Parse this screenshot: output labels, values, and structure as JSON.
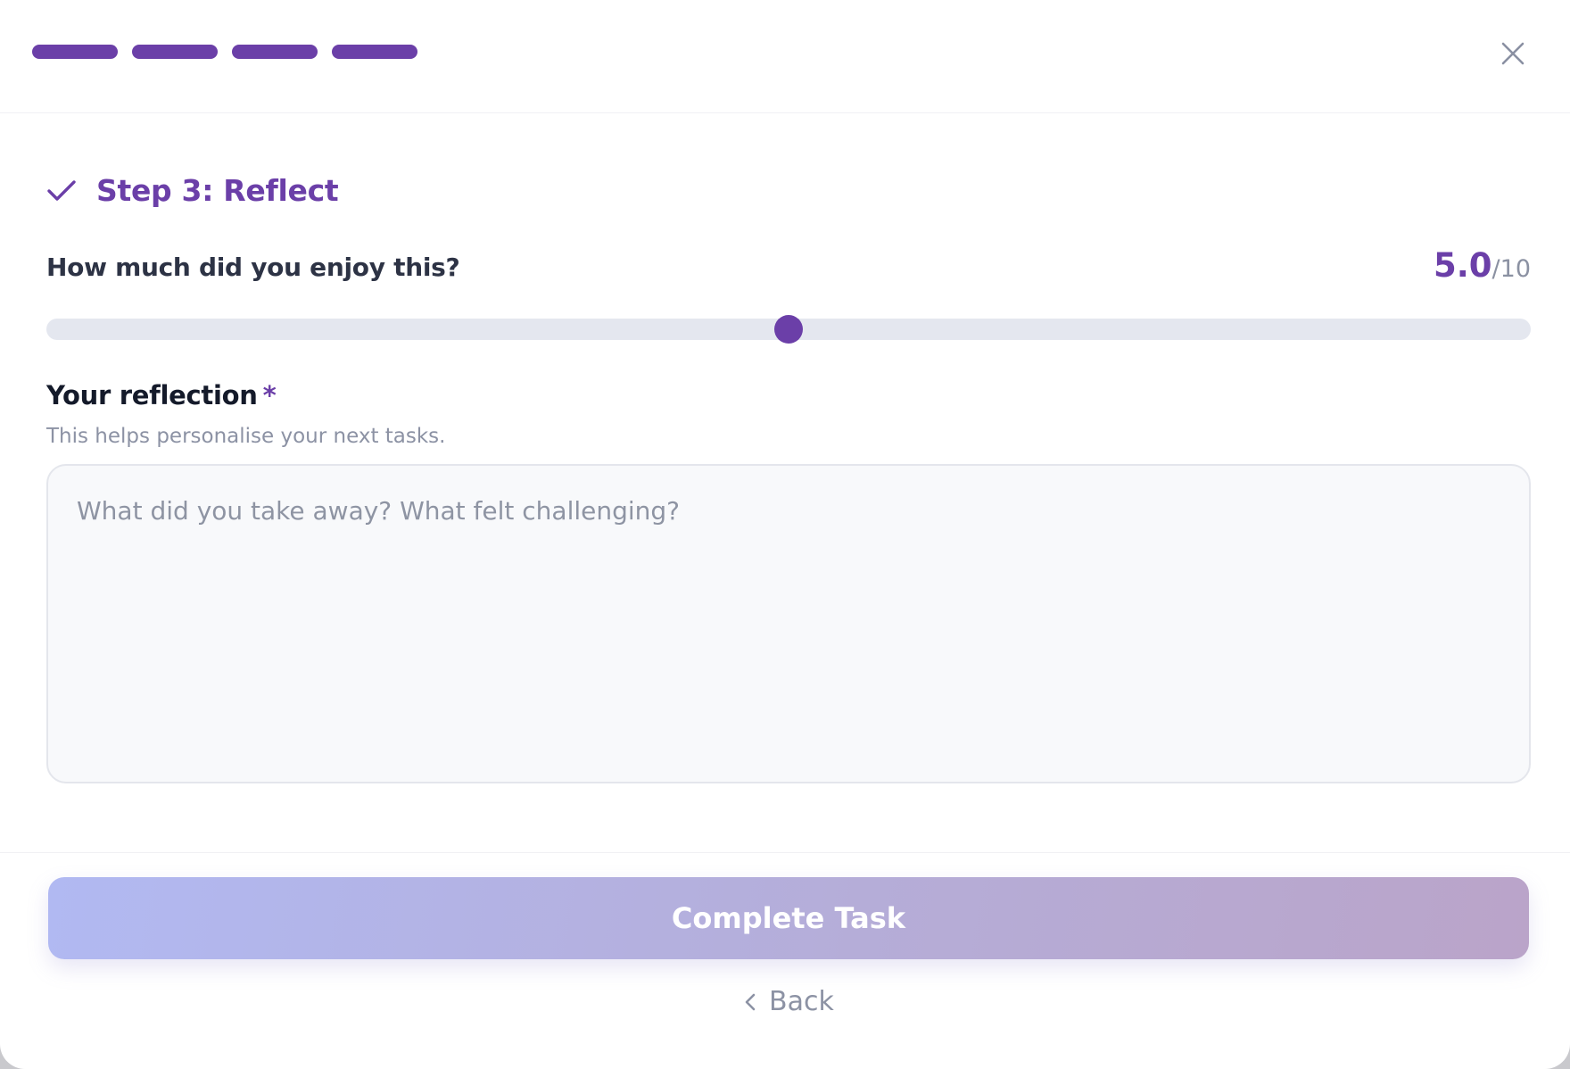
{
  "progress": {
    "total_steps": 4,
    "completed_steps": 4,
    "accent_color": "#6b3fa8"
  },
  "header": {
    "close_icon": "close-icon"
  },
  "step": {
    "icon": "check-icon",
    "title": "Step 3: Reflect"
  },
  "enjoyment": {
    "label": "How much did you enjoy this?",
    "value_text": "5.0",
    "max_text": "/10",
    "value": 5.0,
    "max": 10
  },
  "reflection": {
    "label": "Your reflection",
    "required_mark": "*",
    "hint": "This helps personalise your next tasks.",
    "value": "",
    "placeholder": "What did you take away? What felt challenging?"
  },
  "actions": {
    "complete_label": "Complete Task",
    "back_label": "Back",
    "back_icon": "chevron-left-icon"
  },
  "colors": {
    "accent": "#6b3fa8",
    "button_gradient_start": "#b1b9f2",
    "button_gradient_end": "#baa4c9"
  }
}
